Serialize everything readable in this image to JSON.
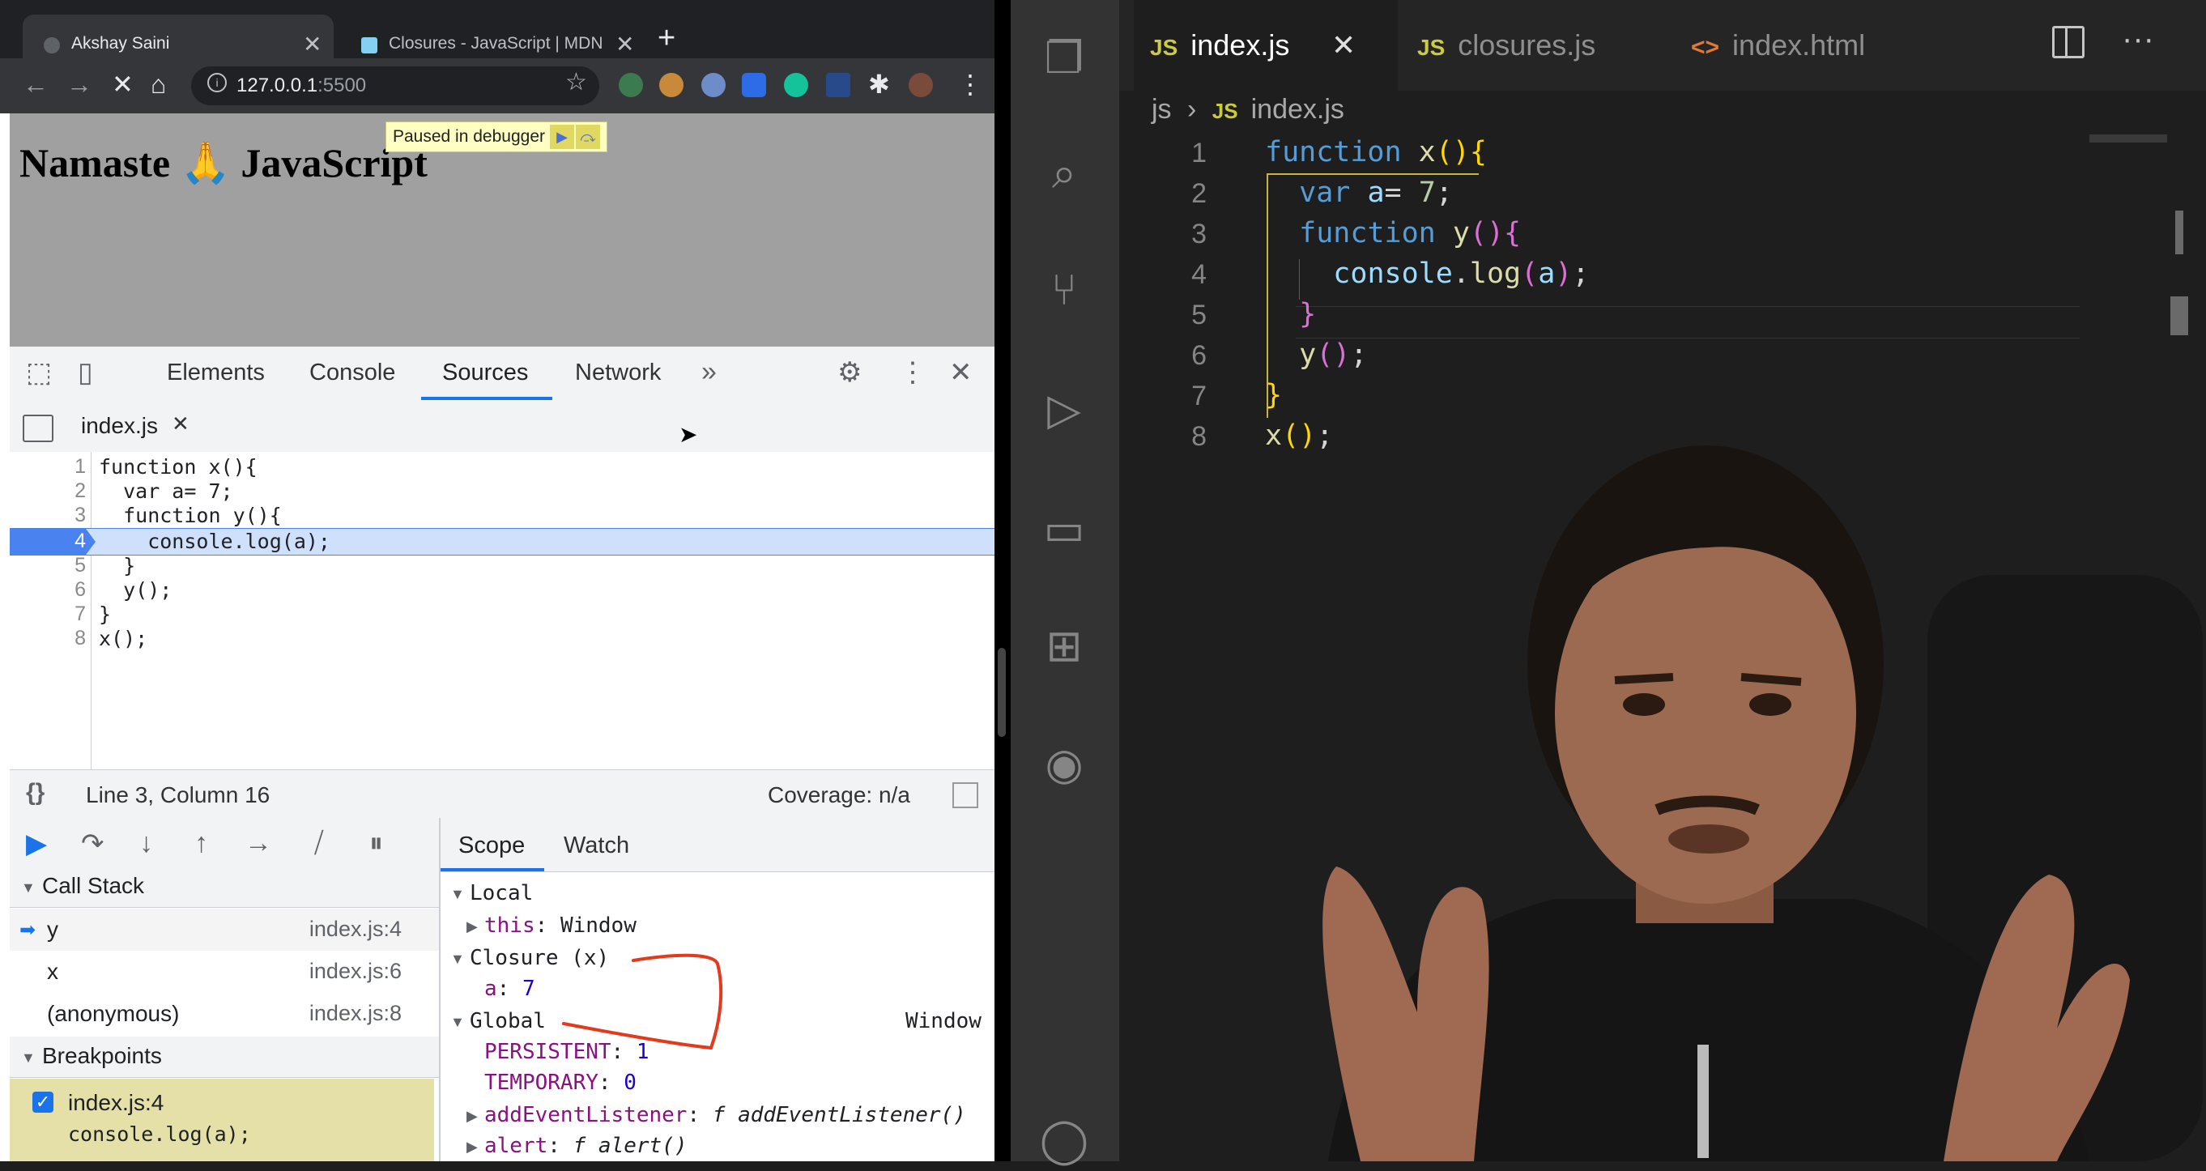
{
  "browser": {
    "tabs": [
      {
        "title": "Akshay Saini",
        "active": true
      },
      {
        "title": "Closures - JavaScript | MDN",
        "active": false
      }
    ],
    "url_host": "127.0.0.1",
    "url_port": ":5500",
    "page_heading": "Namaste 🙏 JavaScript",
    "paused_text": "Paused in debugger"
  },
  "devtools": {
    "tabs": [
      "Elements",
      "Console",
      "Sources",
      "Network"
    ],
    "active_tab": "Sources",
    "open_file": "index.js",
    "code_lines": [
      {
        "n": "1",
        "text": "function x(){"
      },
      {
        "n": "2",
        "text": "  var a= 7;"
      },
      {
        "n": "3",
        "text": "  function y(){"
      },
      {
        "n": "4",
        "text": "    console.log(a);"
      },
      {
        "n": "5",
        "text": "  }"
      },
      {
        "n": "6",
        "text": "  y();"
      },
      {
        "n": "7",
        "text": "}"
      },
      {
        "n": "8",
        "text": "x();"
      }
    ],
    "current_line": 4,
    "status_position": "Line 3, Column 16",
    "status_coverage": "Coverage: n/a",
    "call_stack_label": "Call Stack",
    "call_stack": [
      {
        "name": "y",
        "loc": "index.js:4",
        "current": true
      },
      {
        "name": "x",
        "loc": "index.js:6",
        "current": false
      },
      {
        "name": "(anonymous)",
        "loc": "index.js:8",
        "current": false
      }
    ],
    "breakpoints_label": "Breakpoints",
    "breakpoint": {
      "file": "index.js:4",
      "code": "console.log(a);",
      "checked": true
    },
    "scope_tabs": [
      "Scope",
      "Watch"
    ],
    "scope": {
      "local": "Local",
      "this_key": "this",
      "this_val": "Window",
      "closure": "Closure (x)",
      "closure_var_key": "a",
      "closure_var_val": "7",
      "global": "Global",
      "global_val": "Window",
      "persistent_key": "PERSISTENT",
      "persistent_val": "1",
      "temporary_key": "TEMPORARY",
      "temporary_val": "0",
      "add_listener_key": "addEventListener",
      "add_listener_val": "f addEventListener()",
      "alert_key": "alert",
      "alert_val": "f alert()"
    }
  },
  "vscode": {
    "tabs": [
      {
        "label": "index.js",
        "type": "js",
        "active": true
      },
      {
        "label": "closures.js",
        "type": "js",
        "active": false
      },
      {
        "label": "index.html",
        "type": "html",
        "active": false
      }
    ],
    "breadcrumb_folder": "js",
    "breadcrumb_file": "index.js",
    "line_numbers": [
      "1",
      "2",
      "3",
      "4",
      "5",
      "6",
      "7",
      "8"
    ],
    "accent_colors": {
      "keyword": "#569cd6",
      "function": "#dcdcaa",
      "variable": "#9cdcfe",
      "number": "#b5cea8"
    }
  }
}
